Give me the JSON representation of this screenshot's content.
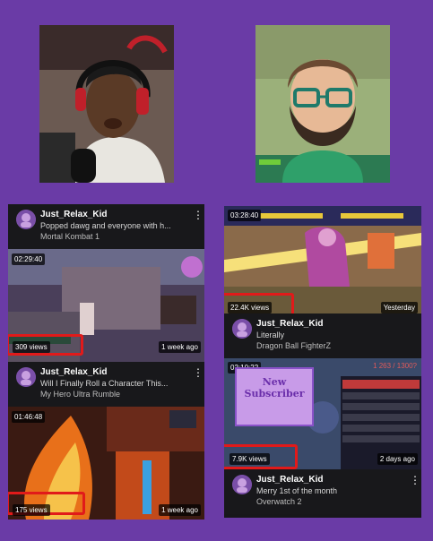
{
  "left_column": {
    "card1": {
      "channel": "Just_Relax_Kid",
      "title": "Popped dawg and everyone with h...",
      "game": "Mortal Kombat 1"
    },
    "clip1": {
      "duration": "02:29:40",
      "views": "309 views",
      "age": "1 week ago"
    },
    "card2": {
      "channel": "Just_Relax_Kid",
      "title": "Will I Finally Roll a Character This...",
      "game": "My Hero Ultra Rumble"
    },
    "clip2": {
      "duration": "01:46:48",
      "views": "175 views",
      "age": "1 week ago"
    }
  },
  "right_column": {
    "clip1": {
      "duration": "03:28:40",
      "views": "22.4K views",
      "age": "Yesterday"
    },
    "card1": {
      "channel": "Just_Relax_Kid",
      "title": "Literally",
      "game": "Dragon Ball FighterZ"
    },
    "clip2": {
      "duration": "02:10:22",
      "views": "7.9K views",
      "age": "2 days ago",
      "counter": "1 263 / 1300?",
      "overlay": "New\nSubscriber"
    },
    "card2": {
      "channel": "Just_Relax_Kid",
      "title": "Merry 1st of the month",
      "game": "Overwatch 2"
    }
  },
  "colors": {
    "background": "#6a3ba6",
    "highlight": "#e11a1a",
    "card": "#18181b"
  },
  "icons": [
    "more-options-icon",
    "channel-avatar-icon"
  ]
}
